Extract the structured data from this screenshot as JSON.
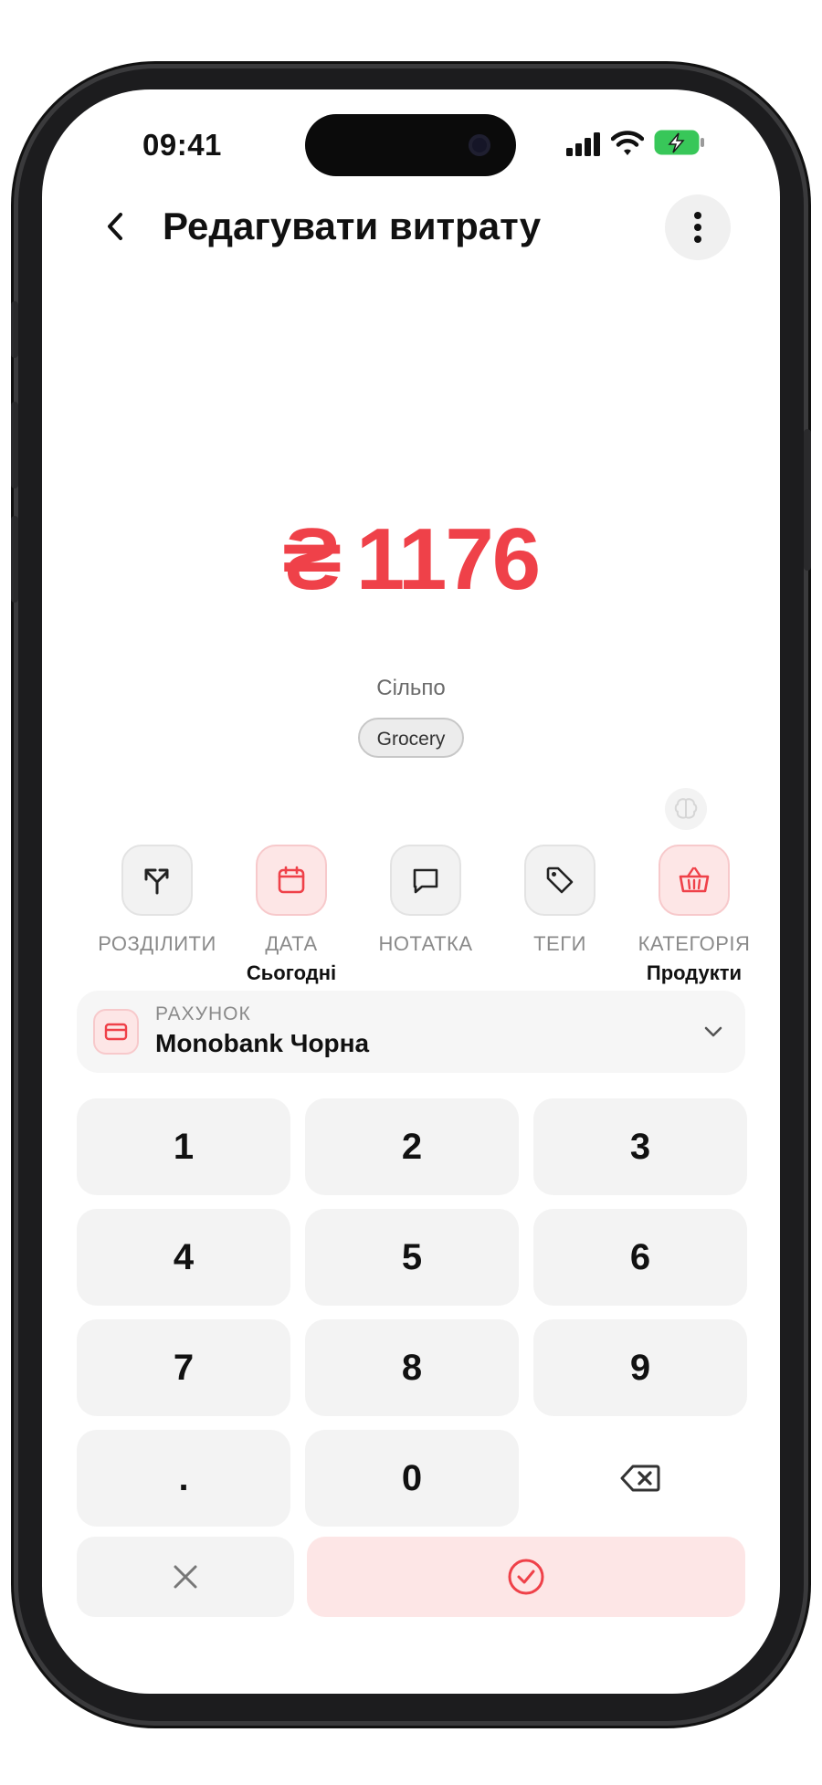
{
  "status_bar": {
    "time": "09:41"
  },
  "header": {
    "title": "Редагувати витрату"
  },
  "transaction": {
    "currency_symbol": "₴",
    "amount": "1176",
    "merchant": "Сільпо",
    "tag": "Grocery"
  },
  "actions": [
    {
      "label": "РОЗДІЛИТИ",
      "value": "",
      "icon": "split-icon"
    },
    {
      "label": "ДАТА",
      "value": "Сьогодні",
      "icon": "calendar-icon"
    },
    {
      "label": "НОТАТКА",
      "value": "",
      "icon": "note-icon"
    },
    {
      "label": "ТЕГИ",
      "value": "",
      "icon": "tag-icon"
    },
    {
      "label": "КАТЕГОРІЯ",
      "value": "Продукти",
      "icon": "basket-icon"
    }
  ],
  "account": {
    "caption": "РАХУНОК",
    "name": "Monobank Чорна"
  },
  "keypad": {
    "keys": [
      "1",
      "2",
      "3",
      "4",
      "5",
      "6",
      "7",
      "8",
      "9",
      ".",
      "0"
    ]
  },
  "colors": {
    "accent": "#ef4149",
    "accent_light": "#fde6e6",
    "key_bg": "#f3f3f3"
  }
}
